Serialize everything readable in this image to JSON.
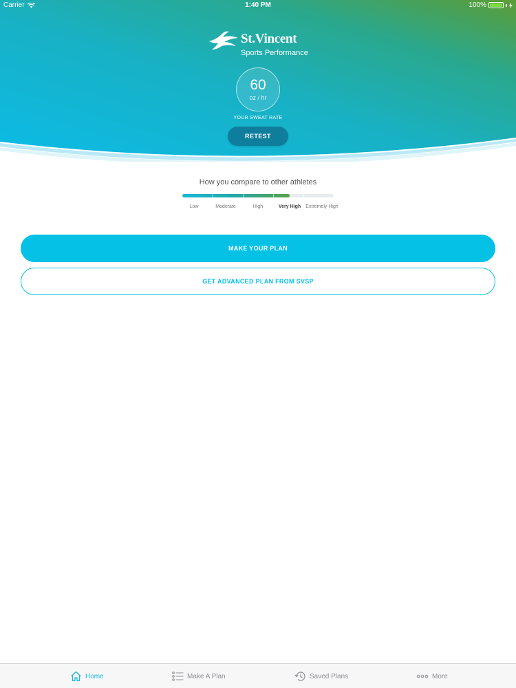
{
  "status_bar": {
    "carrier": "Carrier",
    "time": "1:40 PM",
    "battery": "100%"
  },
  "brand": {
    "name": "St.Vincent",
    "subtitle": "Sports Performance"
  },
  "sweat_rate": {
    "value": "60",
    "unit": "oz / hr",
    "label": "YOUR SWEAT RATE",
    "retest_label": "RETEST"
  },
  "comparison": {
    "title": "How you compare to other athletes",
    "fill_fraction": 0.71,
    "levels": [
      "Low",
      "Moderate",
      "High",
      "Very High",
      "Extremely High"
    ],
    "active_level": "Very High"
  },
  "actions": {
    "make_plan_label": "MAKE YOUR PLAN",
    "advanced_plan_label": "GET ADVANCED PLAN FROM SVSP"
  },
  "tabbar": {
    "tabs": [
      {
        "label": "Home",
        "icon": "home-icon",
        "active": true
      },
      {
        "label": "Make A Plan",
        "icon": "list-icon",
        "active": false
      },
      {
        "label": "Saved Plans",
        "icon": "history-icon",
        "active": false
      },
      {
        "label": "More",
        "icon": "more-icon",
        "active": false
      }
    ]
  },
  "colors": {
    "accent": "#05c1e6",
    "gradient_start": "#0fb7de",
    "gradient_end": "#5a9e3a",
    "retest_bg": "#0f7e9c"
  }
}
